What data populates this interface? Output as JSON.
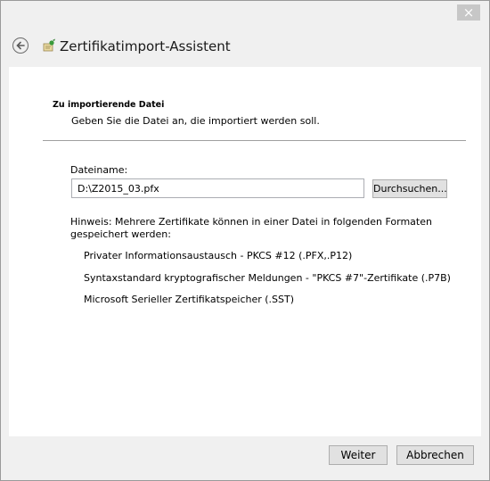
{
  "window": {
    "close_label": "×",
    "title": "Zertifikatimport-Assistent"
  },
  "section": {
    "title": "Zu importierende Datei",
    "description": "Geben Sie die Datei an, die importiert werden soll."
  },
  "file": {
    "label": "Dateiname:",
    "value": "D:\\Z2015_03.pfx",
    "browse_label": "Durchsuchen..."
  },
  "note": "Hinweis: Mehrere Zertifikate können in einer Datei in folgenden Formaten gespeichert werden:",
  "formats": [
    "Privater Informationsaustausch - PKCS #12 (.PFX,.P12)",
    "Syntaxstandard kryptografischer Meldungen - \"PKCS #7\"-Zertifikate (.P7B)",
    "Microsoft Serieller Zertifikatspeicher (.SST)"
  ],
  "footer": {
    "next_label": "Weiter",
    "cancel_label": "Abbrechen"
  },
  "icons": {
    "back": "back-arrow-icon",
    "wizard": "certificate-wizard-icon",
    "close": "close-icon"
  }
}
